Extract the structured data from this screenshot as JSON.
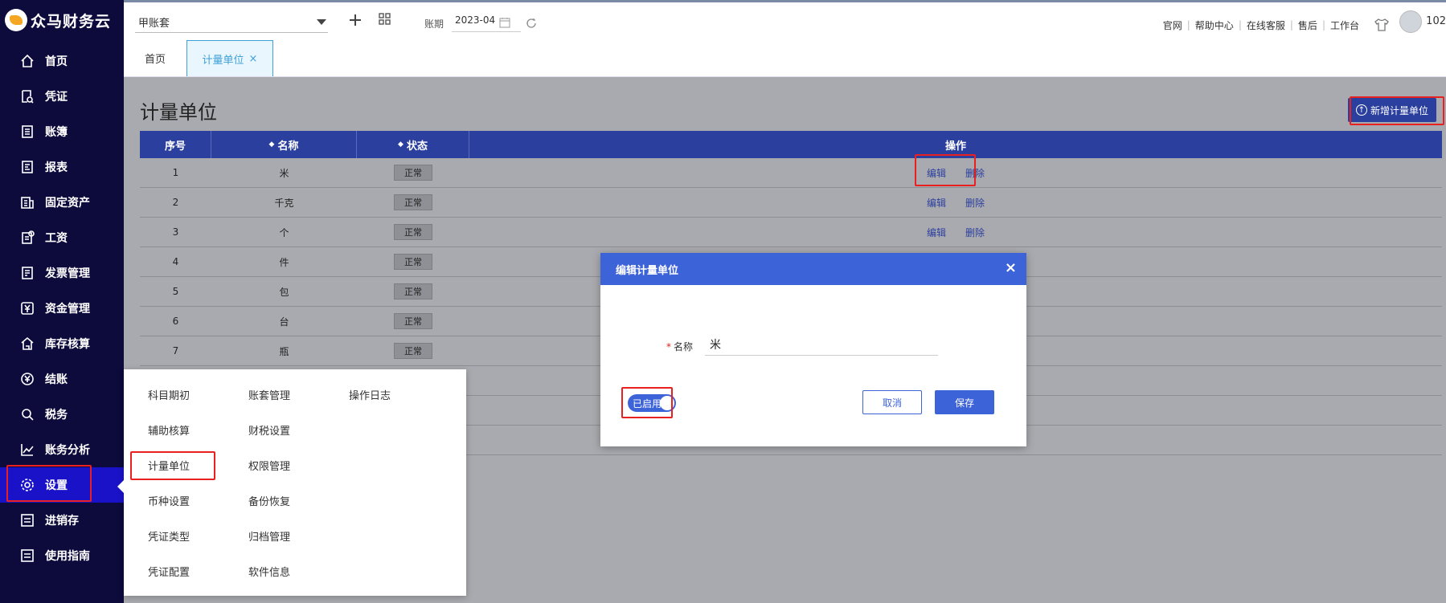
{
  "app": {
    "logo_text": "众马财务云"
  },
  "sidebar": {
    "items": [
      {
        "label": "首页",
        "icon": "home-icon"
      },
      {
        "label": "凭证",
        "icon": "voucher-icon"
      },
      {
        "label": "账簿",
        "icon": "ledger-icon"
      },
      {
        "label": "报表",
        "icon": "report-icon"
      },
      {
        "label": "固定资产",
        "icon": "asset-icon"
      },
      {
        "label": "工资",
        "icon": "salary-icon"
      },
      {
        "label": "发票管理",
        "icon": "invoice-icon"
      },
      {
        "label": "资金管理",
        "icon": "fund-icon"
      },
      {
        "label": "库存核算",
        "icon": "inventory-icon"
      },
      {
        "label": "结账",
        "icon": "checkout-icon"
      },
      {
        "label": "税务",
        "icon": "tax-icon"
      },
      {
        "label": "账务分析",
        "icon": "analysis-icon"
      },
      {
        "label": "设置",
        "icon": "gear-icon",
        "active": true
      },
      {
        "label": "进销存",
        "icon": "purchase-sales-icon"
      },
      {
        "label": "使用指南",
        "icon": "guide-icon"
      }
    ]
  },
  "topbar": {
    "account_book": "甲账套",
    "period_label": "账期",
    "period_value": "2023-04",
    "links": [
      "官网",
      "帮助中心",
      "在线客服",
      "售后",
      "工作台"
    ],
    "username": "102"
  },
  "tabs": [
    {
      "label": "首页"
    },
    {
      "label": "计量单位",
      "close": "×"
    }
  ],
  "page": {
    "title": "计量单位",
    "add_button": "新增计量单位"
  },
  "table": {
    "headers": {
      "index": "序号",
      "name": "名称",
      "status": "状态",
      "actions": "操作"
    },
    "rows": [
      {
        "index": "1",
        "name": "米",
        "status": "正常",
        "edit": "编辑",
        "delete": "删除"
      },
      {
        "index": "2",
        "name": "千克",
        "status": "正常",
        "edit": "编辑",
        "delete": "删除"
      },
      {
        "index": "3",
        "name": "个",
        "status": "正常",
        "edit": "编辑",
        "delete": "删除"
      },
      {
        "index": "4",
        "name": "件",
        "status": "正常"
      },
      {
        "index": "5",
        "name": "包",
        "status": "正常"
      },
      {
        "index": "6",
        "name": "台",
        "status": "正常"
      },
      {
        "index": "7",
        "name": "瓶",
        "status": "正常"
      }
    ]
  },
  "settings_menu": {
    "col1": [
      "科目期初",
      "辅助核算",
      "计量单位",
      "币种设置",
      "凭证类型",
      "凭证配置"
    ],
    "col2": [
      "账套管理",
      "财税设置",
      "权限管理",
      "备份恢复",
      "归档管理",
      "软件信息"
    ],
    "col3": [
      "操作日志"
    ]
  },
  "modal": {
    "title": "编辑计量单位",
    "close": "×",
    "required_mark": "*",
    "name_label": "名称",
    "name_value": "米",
    "toggle_label": "已启用",
    "cancel": "取消",
    "save": "保存"
  },
  "colors": {
    "sidebar_bg": "#0d0a3c",
    "sidebar_active": "#1a12c8",
    "table_header": "#2b3f9e",
    "modal_header": "#3d63d8",
    "highlight_box": "#e82020"
  }
}
